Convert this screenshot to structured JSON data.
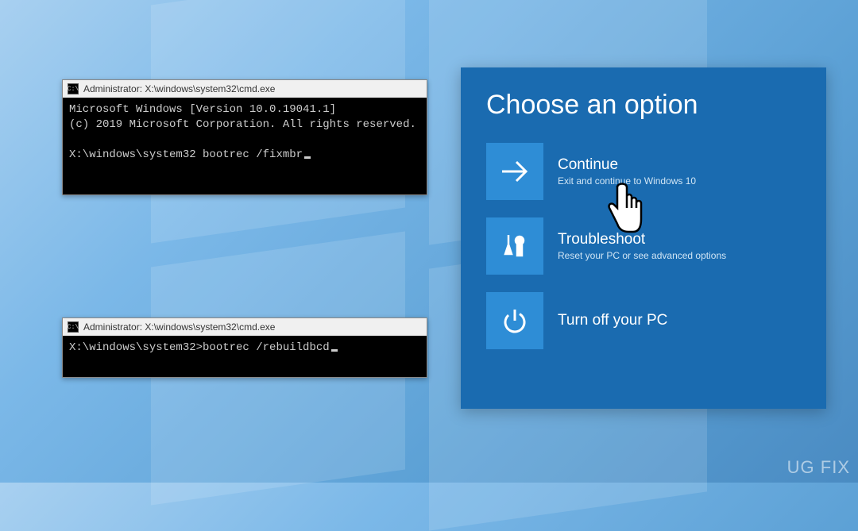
{
  "cmd1": {
    "title": "Administrator: X:\\windows\\system32\\cmd.exe",
    "line1": "Microsoft Windows [Version 10.0.19041.1]",
    "line2": "(c) 2019 Microsoft Corporation. All rights reserved.",
    "prompt": "X:\\windows\\system32 bootrec /fixmbr"
  },
  "cmd2": {
    "title": "Administrator: X:\\windows\\system32\\cmd.exe",
    "prompt": "X:\\windows\\system32>bootrec /rebuildbcd"
  },
  "choose": {
    "heading": "Choose an option",
    "options": [
      {
        "title": "Continue",
        "sub": "Exit and continue to Windows 10"
      },
      {
        "title": "Troubleshoot",
        "sub": "Reset your PC or see advanced options"
      },
      {
        "title": "Turn off your PC",
        "sub": ""
      }
    ]
  },
  "watermark": "UG   FIX"
}
